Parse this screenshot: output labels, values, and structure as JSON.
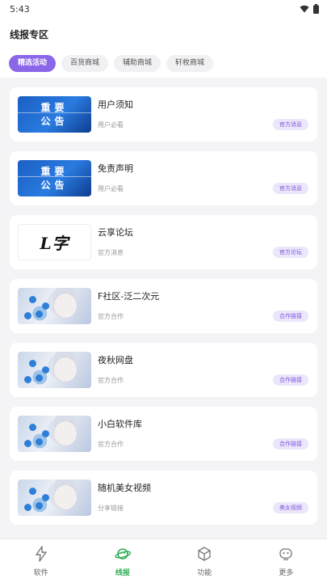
{
  "status_bar": {
    "time": "5:43"
  },
  "page": {
    "title": "线报专区"
  },
  "tabs": [
    {
      "label": "精选活动",
      "active": true
    },
    {
      "label": "百货商城",
      "active": false
    },
    {
      "label": "辅助商城",
      "active": false
    },
    {
      "label": "轩枚商城",
      "active": false
    }
  ],
  "thumb_text": {
    "line1": "重要",
    "line2": "公告",
    "logo": "L字"
  },
  "items": [
    {
      "title": "用户须知",
      "subtitle": "用户必看",
      "badge": "官方消息",
      "thumb": "notice"
    },
    {
      "title": "免责声明",
      "subtitle": "用户必看",
      "badge": "官方消息",
      "thumb": "notice"
    },
    {
      "title": "云享论坛",
      "subtitle": "官方消息",
      "badge": "官方论坛",
      "thumb": "logo"
    },
    {
      "title": "F社区-泛二次元",
      "subtitle": "官方合作",
      "badge": "合作链接",
      "thumb": "anime"
    },
    {
      "title": "夜秋网盘",
      "subtitle": "官方合作",
      "badge": "合作链接",
      "thumb": "anime"
    },
    {
      "title": "小白软件库",
      "subtitle": "官方合作",
      "badge": "合作链接",
      "thumb": "anime"
    },
    {
      "title": "随机美女视频",
      "subtitle": "分享链接",
      "badge": "美女视频",
      "thumb": "anime"
    }
  ],
  "bottom_nav": [
    {
      "label": "软件",
      "icon": "lightning-icon",
      "active": false
    },
    {
      "label": "线报",
      "icon": "planet-icon",
      "active": true
    },
    {
      "label": "功能",
      "icon": "cube-icon",
      "active": false
    },
    {
      "label": "更多",
      "icon": "robot-icon",
      "active": false
    }
  ],
  "colors": {
    "accent": "#8a66e8",
    "nav_active": "#2fae52",
    "badge_bg": "#ece6fb"
  }
}
